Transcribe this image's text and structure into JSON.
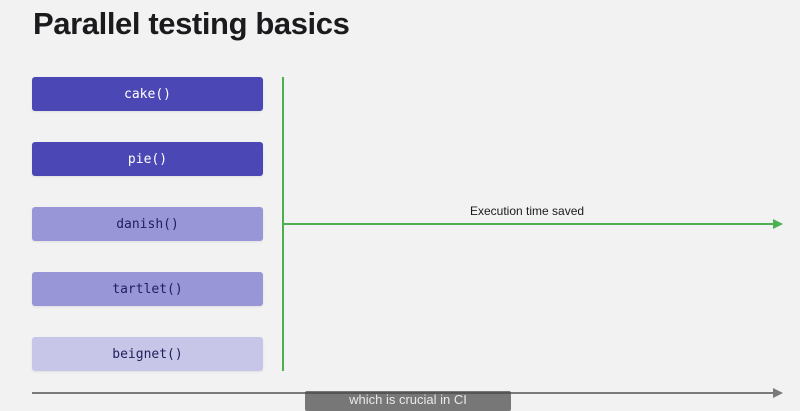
{
  "slide": {
    "title": "Parallel testing basics"
  },
  "tests": [
    {
      "label": "cake()",
      "bg": "#4b48b5",
      "fg": "#ffffff"
    },
    {
      "label": "pie()",
      "bg": "#4b48b5",
      "fg": "#ffffff"
    },
    {
      "label": "danish()",
      "bg": "#9896d6",
      "fg": "#1f1f5c"
    },
    {
      "label": "tartlet()",
      "bg": "#9896d6",
      "fg": "#1f1f5c"
    },
    {
      "label": "beignet()",
      "bg": "#c7c6e8",
      "fg": "#1f1f5c"
    }
  ],
  "timeline": {
    "saved_label": "Execution time saved",
    "saved_color": "#4caf50",
    "axis_color": "#7a7a7a"
  },
  "caption": {
    "text": "which is crucial in CI"
  }
}
